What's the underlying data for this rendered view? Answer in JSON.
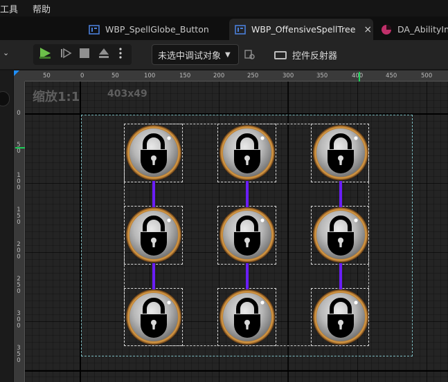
{
  "menu": {
    "items": [
      "工具",
      "帮助"
    ]
  },
  "tabs": [
    {
      "label": "WBP_SpellGlobe_Button",
      "active": false,
      "icon": "widget-blueprint-icon"
    },
    {
      "label": "WBP_OffensiveSpellTree",
      "active": true,
      "icon": "widget-blueprint-icon",
      "close": "×"
    },
    {
      "label": "DA_AbilityInf",
      "active": false,
      "icon": "data-asset-icon"
    }
  ],
  "toolbar": {
    "debug_object": "未选中调试对象",
    "widget_reflector": "控件反射器",
    "play_color": "#6cc04a"
  },
  "designer": {
    "zoom": "缩放1:1",
    "size": "403x49",
    "ruler_top": [
      "50",
      "0",
      "50",
      "100",
      "150",
      "200",
      "250",
      "300",
      "350",
      "400",
      "450",
      "500"
    ],
    "ruler_left": [
      {
        "text": "0"
      },
      {
        "text": "5 0"
      },
      {
        "text": "1 0 0"
      },
      {
        "text": "1 5 0"
      },
      {
        "text": "2 0 0"
      },
      {
        "text": "2 5 0"
      },
      {
        "text": "3 0 0"
      },
      {
        "text": "3 5 0"
      }
    ],
    "connector_color": "#6a1ef5",
    "globe_ring_color": "#c98a3a",
    "globes": [
      {
        "name": "locked-spell-globe"
      },
      {
        "name": "locked-spell-globe"
      },
      {
        "name": "locked-spell-globe"
      },
      {
        "name": "locked-spell-globe"
      },
      {
        "name": "locked-spell-globe"
      },
      {
        "name": "locked-spell-globe"
      },
      {
        "name": "locked-spell-globe"
      },
      {
        "name": "locked-spell-globe"
      },
      {
        "name": "locked-spell-globe"
      }
    ]
  }
}
